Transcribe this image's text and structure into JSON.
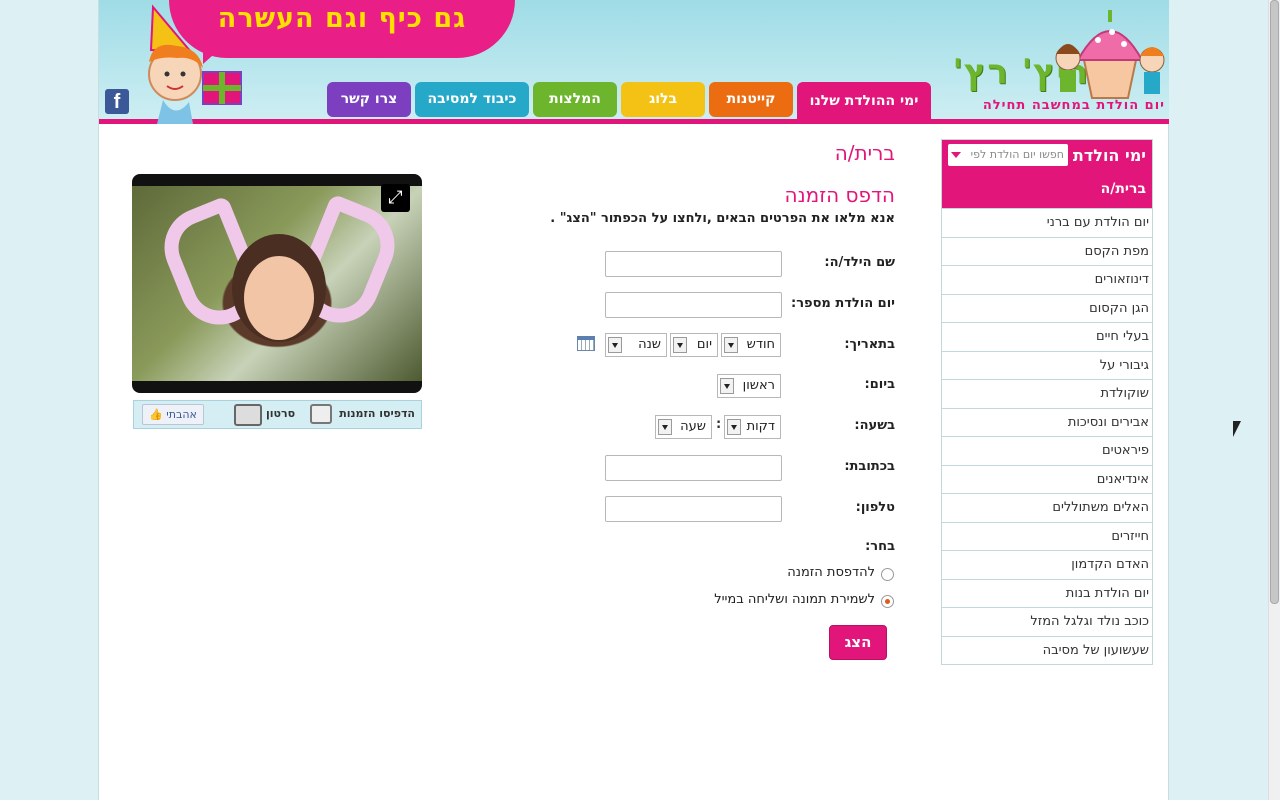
{
  "header": {
    "bubble_slogan": "גם כיף וגם העשרה",
    "logo_name": "ריץ' רץ'",
    "logo_tagline": "יום הולדת במחשבה תחילה",
    "facebook_letter": "f"
  },
  "nav": {
    "tabs": [
      {
        "label": "ימי ההולדת שלנו",
        "color": "#e2157a",
        "active": true
      },
      {
        "label": "קייטנות",
        "color": "#ec6c11"
      },
      {
        "label": "בלוג",
        "color": "#f4c214"
      },
      {
        "label": "המלצות",
        "color": "#6cb52d"
      },
      {
        "label": "כיבוד למסיבה",
        "color": "#26a9c9"
      },
      {
        "label": "צרו קשר",
        "color": "#7b3fbf"
      }
    ]
  },
  "sidebar": {
    "heading": "ימי הולדת",
    "search_placeholder": "חפשו יום הולדת לפי",
    "current": "ברית/ה",
    "items": [
      "יום הולדת עם ברני",
      "מפת הקסם",
      "דינוזאורים",
      "הגן הקסום",
      "בעלי חיים",
      "גיבורי על",
      "שוקולדת",
      "אבירים ונסיכות",
      "פיראטים",
      "אינדיאנים",
      "האלים משתוללים",
      "חייזרים",
      "האדם הקדמון",
      "יום הולדת בנות",
      "כוכב נולד וגלגל המזל",
      "שעשועון של מסיבה"
    ]
  },
  "main": {
    "title": "ברית/ה",
    "subtitle": "הדפס הזמנה",
    "instructions": "אנא מלאו את הפרטים הבאים ,ולחצו על הכפתור \"הצג\" ."
  },
  "form": {
    "child_name_label": "שם הילד/ה:",
    "birthday_number_label": "יום הולדת מספר:",
    "date_label": "בתאריך:",
    "month_select": "חודש",
    "day_select": "יום",
    "year_select": "שנה",
    "weekday_label": "ביום:",
    "weekday_select": "ראשון",
    "time_label": "בשעה:",
    "minutes_select": "דקות",
    "hour_select": "שעה",
    "time_separator": ":",
    "address_label": "בכתובת:",
    "phone_label": "טלפון:",
    "choose_label": "בחר:",
    "option_print": "להדפסת הזמנה",
    "option_email": "לשמירת תמונה ושליחה במייל",
    "submit_label": "הצג"
  },
  "media": {
    "print_invites": "הדפיסו הזמנות",
    "video": "סרטון",
    "like": "אהבתי",
    "expand_icon": "expand-icon"
  }
}
